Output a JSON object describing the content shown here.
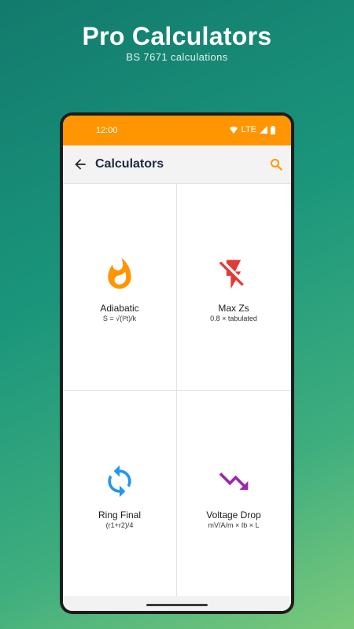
{
  "promo": {
    "title": "Pro Calculators",
    "subtitle": "BS 7671 calculations"
  },
  "status_bar": {
    "time": "12:00",
    "network": "LTE"
  },
  "app_bar": {
    "title": "Calculators"
  },
  "calculators": [
    {
      "name": "Adiabatic",
      "formula": "S = √(I²t)/k",
      "icon": "flame-icon",
      "color": "#ff9500"
    },
    {
      "name": "Max Zs",
      "formula": "0.8 × tabulated",
      "icon": "flash-off-icon",
      "color": "#e53935"
    },
    {
      "name": "Ring Final",
      "formula": "(r1+r2)/4",
      "icon": "sync-icon",
      "color": "#2196f3"
    },
    {
      "name": "Voltage Drop",
      "formula": "mV/A/m × Ib × L",
      "icon": "trending-down-icon",
      "color": "#9c27b0"
    }
  ],
  "colors": {
    "accent": "#ff9500",
    "title_text": "#1f2a44"
  }
}
